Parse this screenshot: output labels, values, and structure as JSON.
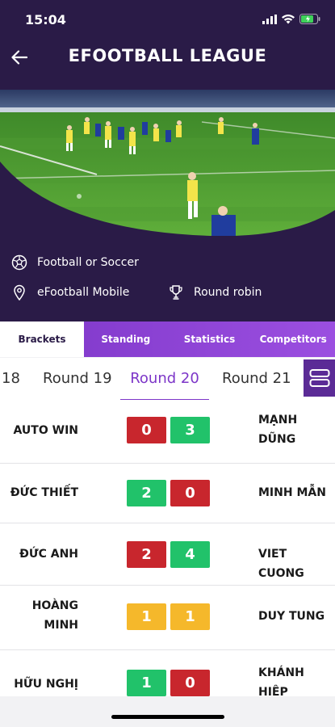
{
  "status": {
    "time": "15:04"
  },
  "header": {
    "title": "EFOOTBALL LEAGUE"
  },
  "info": {
    "sport": "Football or Soccer",
    "game": "eFootball Mobile",
    "format": "Round robin"
  },
  "tabs": [
    {
      "label": "Brackets",
      "active": true
    },
    {
      "label": "Standing",
      "active": false
    },
    {
      "label": "Statistics",
      "active": false
    },
    {
      "label": "Competitors",
      "active": false
    }
  ],
  "rounds": [
    {
      "label": "18"
    },
    {
      "label": "Round 19"
    },
    {
      "label": "Round 20",
      "active": true
    },
    {
      "label": "Round 21"
    }
  ],
  "matches": [
    {
      "home": "AUTO WIN",
      "home_score": "0",
      "away_score": "3",
      "away": "MẠNH DŨNG",
      "home_color": "#c8262d",
      "away_color": "#21c26a"
    },
    {
      "home": "ĐỨC THIẾT",
      "home_score": "2",
      "away_score": "0",
      "away": "MINH MẪN",
      "home_color": "#21c26a",
      "away_color": "#c8262d"
    },
    {
      "home": "ĐỨC ANH",
      "home_score": "2",
      "away_score": "4",
      "away": "VIET CUONG",
      "home_color": "#c8262d",
      "away_color": "#21c26a"
    },
    {
      "home": "HOÀNG MINH",
      "home_score": "1",
      "away_score": "1",
      "away": "DUY TUNG",
      "home_color": "#f5b82b",
      "away_color": "#f5b82b"
    },
    {
      "home": "HỮU NGHỊ",
      "home_score": "1",
      "away_score": "0",
      "away": "KHÁNH HIỆP",
      "home_color": "#21c26a",
      "away_color": "#c8262d"
    }
  ],
  "colors": {
    "header_bg": "#2a1b47",
    "accent": "#7d36c8",
    "win": "#21c26a",
    "loss": "#c8262d",
    "draw": "#f5b82b"
  }
}
